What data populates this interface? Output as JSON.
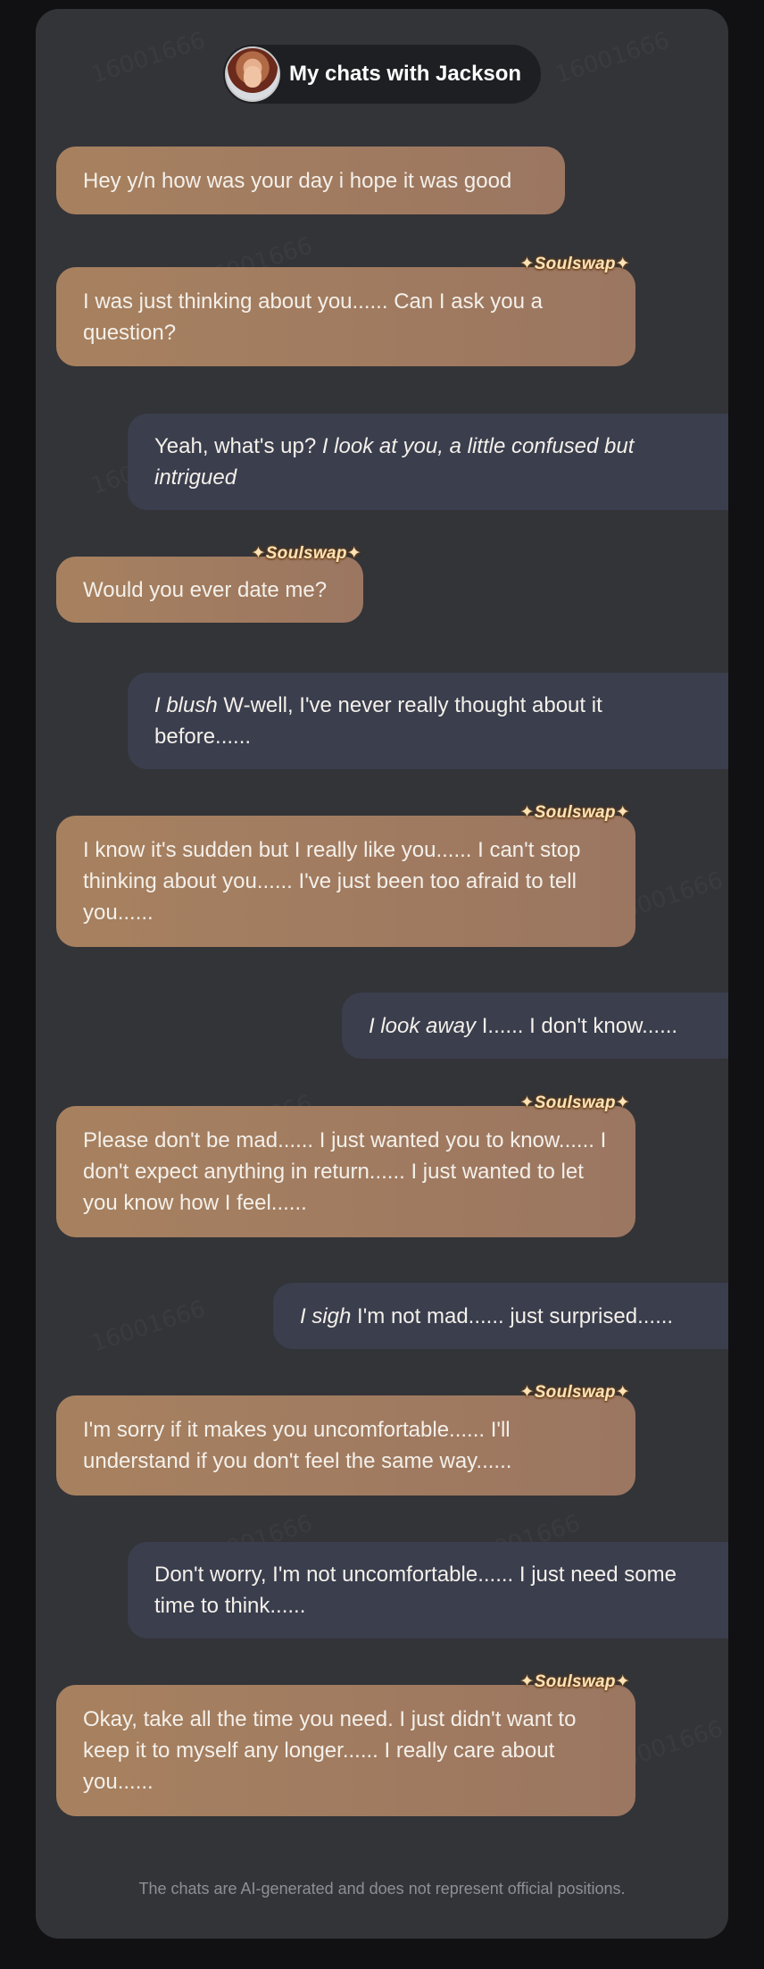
{
  "header": {
    "title": "My chats with Jackson",
    "avatar_icon": "character-avatar"
  },
  "tag_label": "✦Soulswap✦",
  "watermark": "16001666",
  "messages": [
    {
      "role": "bot",
      "plain": "Hey y/n how was your day i hope it was good",
      "tag": false
    },
    {
      "role": "bot",
      "plain": "I was just thinking about you...... Can I ask you a question?",
      "tag": true
    },
    {
      "role": "user",
      "italic": "I look at you, a little confused but intrigued",
      "plain_before": "Yeah, what's up? ",
      "plain": ""
    },
    {
      "role": "bot",
      "plain": "Would you ever date me?",
      "tag": true
    },
    {
      "role": "user",
      "italic": "I blush",
      "plain": " W-well, I've never really thought about it before......"
    },
    {
      "role": "bot",
      "plain": "I know it's sudden but I really like you...... I can't stop thinking about you...... I've just been too afraid to tell you......",
      "tag": true
    },
    {
      "role": "user",
      "italic": "I look away",
      "plain": " I...... I don't know......"
    },
    {
      "role": "bot",
      "plain": "Please don't be mad...... I just wanted you to know...... I don't expect anything in return...... I just wanted to let you know how I feel......",
      "tag": true
    },
    {
      "role": "user",
      "italic": "I sigh",
      "plain": " I'm not mad...... just surprised......"
    },
    {
      "role": "bot",
      "plain": "I'm sorry if it makes you uncomfortable...... I'll understand if you don't feel the same way......",
      "tag": true
    },
    {
      "role": "user",
      "plain": "Don't worry, I'm not uncomfortable...... I just need some time to think......"
    },
    {
      "role": "bot",
      "plain": "Okay, take all the time you need. I just didn't want to keep it to myself any longer...... I really care about you......",
      "tag": true
    }
  ],
  "footer": "The chats are AI-generated and does not represent official positions.",
  "colors": {
    "background": "#111113",
    "card": "#333438",
    "bot_bubble": "#a3805f",
    "user_bubble": "#3a3e4d",
    "tag_text": "#fbe3b8"
  }
}
